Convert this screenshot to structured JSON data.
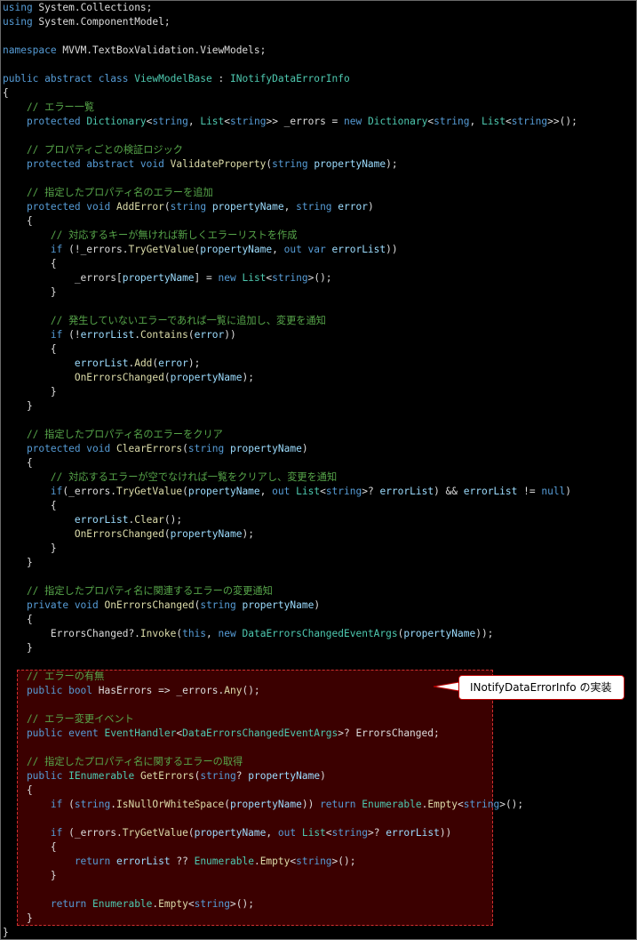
{
  "editor": {
    "lines": [
      [
        [
          "kw",
          "using"
        ],
        [
          "tx",
          " System.Collections;"
        ]
      ],
      [
        [
          "kw",
          "using"
        ],
        [
          "tx",
          " System.ComponentModel;"
        ]
      ],
      [],
      [
        [
          "kw",
          "namespace"
        ],
        [
          "tx",
          " MVVM.TextBoxValidation.ViewModels;"
        ]
      ],
      [],
      [
        [
          "kw",
          "public abstract class"
        ],
        [
          "tx",
          " "
        ],
        [
          "ty",
          "ViewModelBase"
        ],
        [
          "tx",
          " : "
        ],
        [
          "ty",
          "INotifyDataErrorInfo"
        ]
      ],
      [
        [
          "tx",
          "{"
        ]
      ],
      [
        [
          "cm",
          "    // エラー一覧"
        ]
      ],
      [
        [
          "kw",
          "    protected"
        ],
        [
          "tx",
          " "
        ],
        [
          "ty",
          "Dictionary"
        ],
        [
          "tx",
          "<"
        ],
        [
          "kw",
          "string"
        ],
        [
          "tx",
          ", "
        ],
        [
          "ty",
          "List"
        ],
        [
          "tx",
          "<"
        ],
        [
          "kw",
          "string"
        ],
        [
          "tx",
          ">> _errors = "
        ],
        [
          "kw",
          "new"
        ],
        [
          "tx",
          " "
        ],
        [
          "ty",
          "Dictionary"
        ],
        [
          "tx",
          "<"
        ],
        [
          "kw",
          "string"
        ],
        [
          "tx",
          ", "
        ],
        [
          "ty",
          "List"
        ],
        [
          "tx",
          "<"
        ],
        [
          "kw",
          "string"
        ],
        [
          "tx",
          ">>();"
        ]
      ],
      [],
      [
        [
          "cm",
          "    // プロパティごとの検証ロジック"
        ]
      ],
      [
        [
          "kw",
          "    protected abstract void"
        ],
        [
          "tx",
          " "
        ],
        [
          "fn",
          "ValidateProperty"
        ],
        [
          "tx",
          "("
        ],
        [
          "kw",
          "string"
        ],
        [
          "tx",
          " "
        ],
        [
          "pm",
          "propertyName"
        ],
        [
          "tx",
          ");"
        ]
      ],
      [],
      [
        [
          "cm",
          "    // 指定したプロパティ名のエラーを追加"
        ]
      ],
      [
        [
          "kw",
          "    protected void"
        ],
        [
          "tx",
          " "
        ],
        [
          "fn",
          "AddError"
        ],
        [
          "tx",
          "("
        ],
        [
          "kw",
          "string"
        ],
        [
          "tx",
          " "
        ],
        [
          "pm",
          "propertyName"
        ],
        [
          "tx",
          ", "
        ],
        [
          "kw",
          "string"
        ],
        [
          "tx",
          " "
        ],
        [
          "pm",
          "error"
        ],
        [
          "tx",
          ")"
        ]
      ],
      [
        [
          "tx",
          "    {"
        ]
      ],
      [
        [
          "cm",
          "        // 対応するキーが無ければ新しくエラーリストを作成"
        ]
      ],
      [
        [
          "kw",
          "        if"
        ],
        [
          "tx",
          " (!_errors."
        ],
        [
          "fn",
          "TryGetValue"
        ],
        [
          "tx",
          "("
        ],
        [
          "pm",
          "propertyName"
        ],
        [
          "tx",
          ", "
        ],
        [
          "kw",
          "out var"
        ],
        [
          "tx",
          " "
        ],
        [
          "pm",
          "errorList"
        ],
        [
          "tx",
          "))"
        ]
      ],
      [
        [
          "tx",
          "        {"
        ]
      ],
      [
        [
          "tx",
          "            _errors["
        ],
        [
          "pm",
          "propertyName"
        ],
        [
          "tx",
          "] = "
        ],
        [
          "kw",
          "new"
        ],
        [
          "tx",
          " "
        ],
        [
          "ty",
          "List"
        ],
        [
          "tx",
          "<"
        ],
        [
          "kw",
          "string"
        ],
        [
          "tx",
          ">();"
        ]
      ],
      [
        [
          "tx",
          "        }"
        ]
      ],
      [],
      [
        [
          "cm",
          "        // 発生していないエラーであれば一覧に追加し、変更を通知"
        ]
      ],
      [
        [
          "kw",
          "        if"
        ],
        [
          "tx",
          " (!"
        ],
        [
          "pm",
          "errorList"
        ],
        [
          "tx",
          "."
        ],
        [
          "fn",
          "Contains"
        ],
        [
          "tx",
          "("
        ],
        [
          "pm",
          "error"
        ],
        [
          "tx",
          "))"
        ]
      ],
      [
        [
          "tx",
          "        {"
        ]
      ],
      [
        [
          "tx",
          "            "
        ],
        [
          "pm",
          "errorList"
        ],
        [
          "tx",
          "."
        ],
        [
          "fn",
          "Add"
        ],
        [
          "tx",
          "("
        ],
        [
          "pm",
          "error"
        ],
        [
          "tx",
          ");"
        ]
      ],
      [
        [
          "tx",
          "            "
        ],
        [
          "fn",
          "OnErrorsChanged"
        ],
        [
          "tx",
          "("
        ],
        [
          "pm",
          "propertyName"
        ],
        [
          "tx",
          ");"
        ]
      ],
      [
        [
          "tx",
          "        }"
        ]
      ],
      [
        [
          "tx",
          "    }"
        ]
      ],
      [],
      [
        [
          "cm",
          "    // 指定したプロパティ名のエラーをクリア"
        ]
      ],
      [
        [
          "kw",
          "    protected void"
        ],
        [
          "tx",
          " "
        ],
        [
          "fn",
          "ClearErrors"
        ],
        [
          "tx",
          "("
        ],
        [
          "kw",
          "string"
        ],
        [
          "tx",
          " "
        ],
        [
          "pm",
          "propertyName"
        ],
        [
          "tx",
          ")"
        ]
      ],
      [
        [
          "tx",
          "    {"
        ]
      ],
      [
        [
          "cm",
          "        // 対応するエラーが空でなければ一覧をクリアし、変更を通知"
        ]
      ],
      [
        [
          "kw",
          "        if"
        ],
        [
          "tx",
          "(_errors."
        ],
        [
          "fn",
          "TryGetValue"
        ],
        [
          "tx",
          "("
        ],
        [
          "pm",
          "propertyName"
        ],
        [
          "tx",
          ", "
        ],
        [
          "kw",
          "out"
        ],
        [
          "tx",
          " "
        ],
        [
          "ty",
          "List"
        ],
        [
          "tx",
          "<"
        ],
        [
          "kw",
          "string"
        ],
        [
          "tx",
          ">? "
        ],
        [
          "pm",
          "errorList"
        ],
        [
          "tx",
          ") && "
        ],
        [
          "pm",
          "errorList"
        ],
        [
          "tx",
          " != "
        ],
        [
          "kw",
          "null"
        ],
        [
          "tx",
          ")"
        ]
      ],
      [
        [
          "tx",
          "        {"
        ]
      ],
      [
        [
          "tx",
          "            "
        ],
        [
          "pm",
          "errorList"
        ],
        [
          "tx",
          "."
        ],
        [
          "fn",
          "Clear"
        ],
        [
          "tx",
          "();"
        ]
      ],
      [
        [
          "tx",
          "            "
        ],
        [
          "fn",
          "OnErrorsChanged"
        ],
        [
          "tx",
          "("
        ],
        [
          "pm",
          "propertyName"
        ],
        [
          "tx",
          ");"
        ]
      ],
      [
        [
          "tx",
          "        }"
        ]
      ],
      [
        [
          "tx",
          "    }"
        ]
      ],
      [],
      [
        [
          "cm",
          "    // 指定したプロパティ名に関連するエラーの変更通知"
        ]
      ],
      [
        [
          "kw",
          "    private void"
        ],
        [
          "tx",
          " "
        ],
        [
          "fn",
          "OnErrorsChanged"
        ],
        [
          "tx",
          "("
        ],
        [
          "kw",
          "string"
        ],
        [
          "tx",
          " "
        ],
        [
          "pm",
          "propertyName"
        ],
        [
          "tx",
          ")"
        ]
      ],
      [
        [
          "tx",
          "    {"
        ]
      ],
      [
        [
          "tx",
          "        ErrorsChanged?."
        ],
        [
          "fn",
          "Invoke"
        ],
        [
          "tx",
          "("
        ],
        [
          "kw",
          "this"
        ],
        [
          "tx",
          ", "
        ],
        [
          "kw",
          "new"
        ],
        [
          "tx",
          " "
        ],
        [
          "ty",
          "DataErrorsChangedEventArgs"
        ],
        [
          "tx",
          "("
        ],
        [
          "pm",
          "propertyName"
        ],
        [
          "tx",
          "));"
        ]
      ],
      [
        [
          "tx",
          "    }"
        ]
      ],
      [],
      [
        [
          "cm",
          "    // エラーの有無"
        ]
      ],
      [
        [
          "kw",
          "    public bool"
        ],
        [
          "tx",
          " HasErrors => _errors."
        ],
        [
          "fn",
          "Any"
        ],
        [
          "tx",
          "();"
        ]
      ],
      [],
      [
        [
          "cm",
          "    // エラー変更イベント"
        ]
      ],
      [
        [
          "kw",
          "    public event"
        ],
        [
          "tx",
          " "
        ],
        [
          "ty",
          "EventHandler"
        ],
        [
          "tx",
          "<"
        ],
        [
          "ty",
          "DataErrorsChangedEventArgs"
        ],
        [
          "tx",
          ">? ErrorsChanged;"
        ]
      ],
      [],
      [
        [
          "cm",
          "    // 指定したプロパティ名に関するエラーの取得"
        ]
      ],
      [
        [
          "kw",
          "    public"
        ],
        [
          "tx",
          " "
        ],
        [
          "ty",
          "IEnumerable"
        ],
        [
          "tx",
          " "
        ],
        [
          "fn",
          "GetErrors"
        ],
        [
          "tx",
          "("
        ],
        [
          "kw",
          "string"
        ],
        [
          "tx",
          "? "
        ],
        [
          "pm",
          "propertyName"
        ],
        [
          "tx",
          ")"
        ]
      ],
      [
        [
          "tx",
          "    {"
        ]
      ],
      [
        [
          "kw",
          "        if"
        ],
        [
          "tx",
          " ("
        ],
        [
          "kw",
          "string"
        ],
        [
          "tx",
          "."
        ],
        [
          "fn",
          "IsNullOrWhiteSpace"
        ],
        [
          "tx",
          "("
        ],
        [
          "pm",
          "propertyName"
        ],
        [
          "tx",
          ")) "
        ],
        [
          "kw",
          "return"
        ],
        [
          "tx",
          " "
        ],
        [
          "ty",
          "Enumerable"
        ],
        [
          "tx",
          "."
        ],
        [
          "fn",
          "Empty"
        ],
        [
          "tx",
          "<"
        ],
        [
          "kw",
          "string"
        ],
        [
          "tx",
          ">();"
        ]
      ],
      [],
      [
        [
          "kw",
          "        if"
        ],
        [
          "tx",
          " (_errors."
        ],
        [
          "fn",
          "TryGetValue"
        ],
        [
          "tx",
          "("
        ],
        [
          "pm",
          "propertyName"
        ],
        [
          "tx",
          ", "
        ],
        [
          "kw",
          "out"
        ],
        [
          "tx",
          " "
        ],
        [
          "ty",
          "List"
        ],
        [
          "tx",
          "<"
        ],
        [
          "kw",
          "string"
        ],
        [
          "tx",
          ">? "
        ],
        [
          "pm",
          "errorList"
        ],
        [
          "tx",
          "))"
        ]
      ],
      [
        [
          "tx",
          "        {"
        ]
      ],
      [
        [
          "kw",
          "            return"
        ],
        [
          "tx",
          " "
        ],
        [
          "pm",
          "errorList"
        ],
        [
          "tx",
          " ?? "
        ],
        [
          "ty",
          "Enumerable"
        ],
        [
          "tx",
          "."
        ],
        [
          "fn",
          "Empty"
        ],
        [
          "tx",
          "<"
        ],
        [
          "kw",
          "string"
        ],
        [
          "tx",
          ">();"
        ]
      ],
      [
        [
          "tx",
          "        }"
        ]
      ],
      [],
      [
        [
          "kw",
          "        return"
        ],
        [
          "tx",
          " "
        ],
        [
          "ty",
          "Enumerable"
        ],
        [
          "tx",
          "."
        ],
        [
          "fn",
          "Empty"
        ],
        [
          "tx",
          "<"
        ],
        [
          "kw",
          "string"
        ],
        [
          "tx",
          ">();"
        ]
      ],
      [
        [
          "tx",
          "    }"
        ]
      ],
      [
        [
          "tx",
          "}"
        ]
      ]
    ]
  },
  "callout": {
    "text": "INotifyDataErrorInfo の実装"
  },
  "colors": {
    "background": "#000000",
    "keyword": "#569cd6",
    "type": "#4ec9b0",
    "method": "#dcdcaa",
    "comment": "#57a64a",
    "identifier": "#9cdcfe",
    "text": "#dcdcdc",
    "highlight_fill": "#3b0000",
    "highlight_border": "#d03030"
  }
}
